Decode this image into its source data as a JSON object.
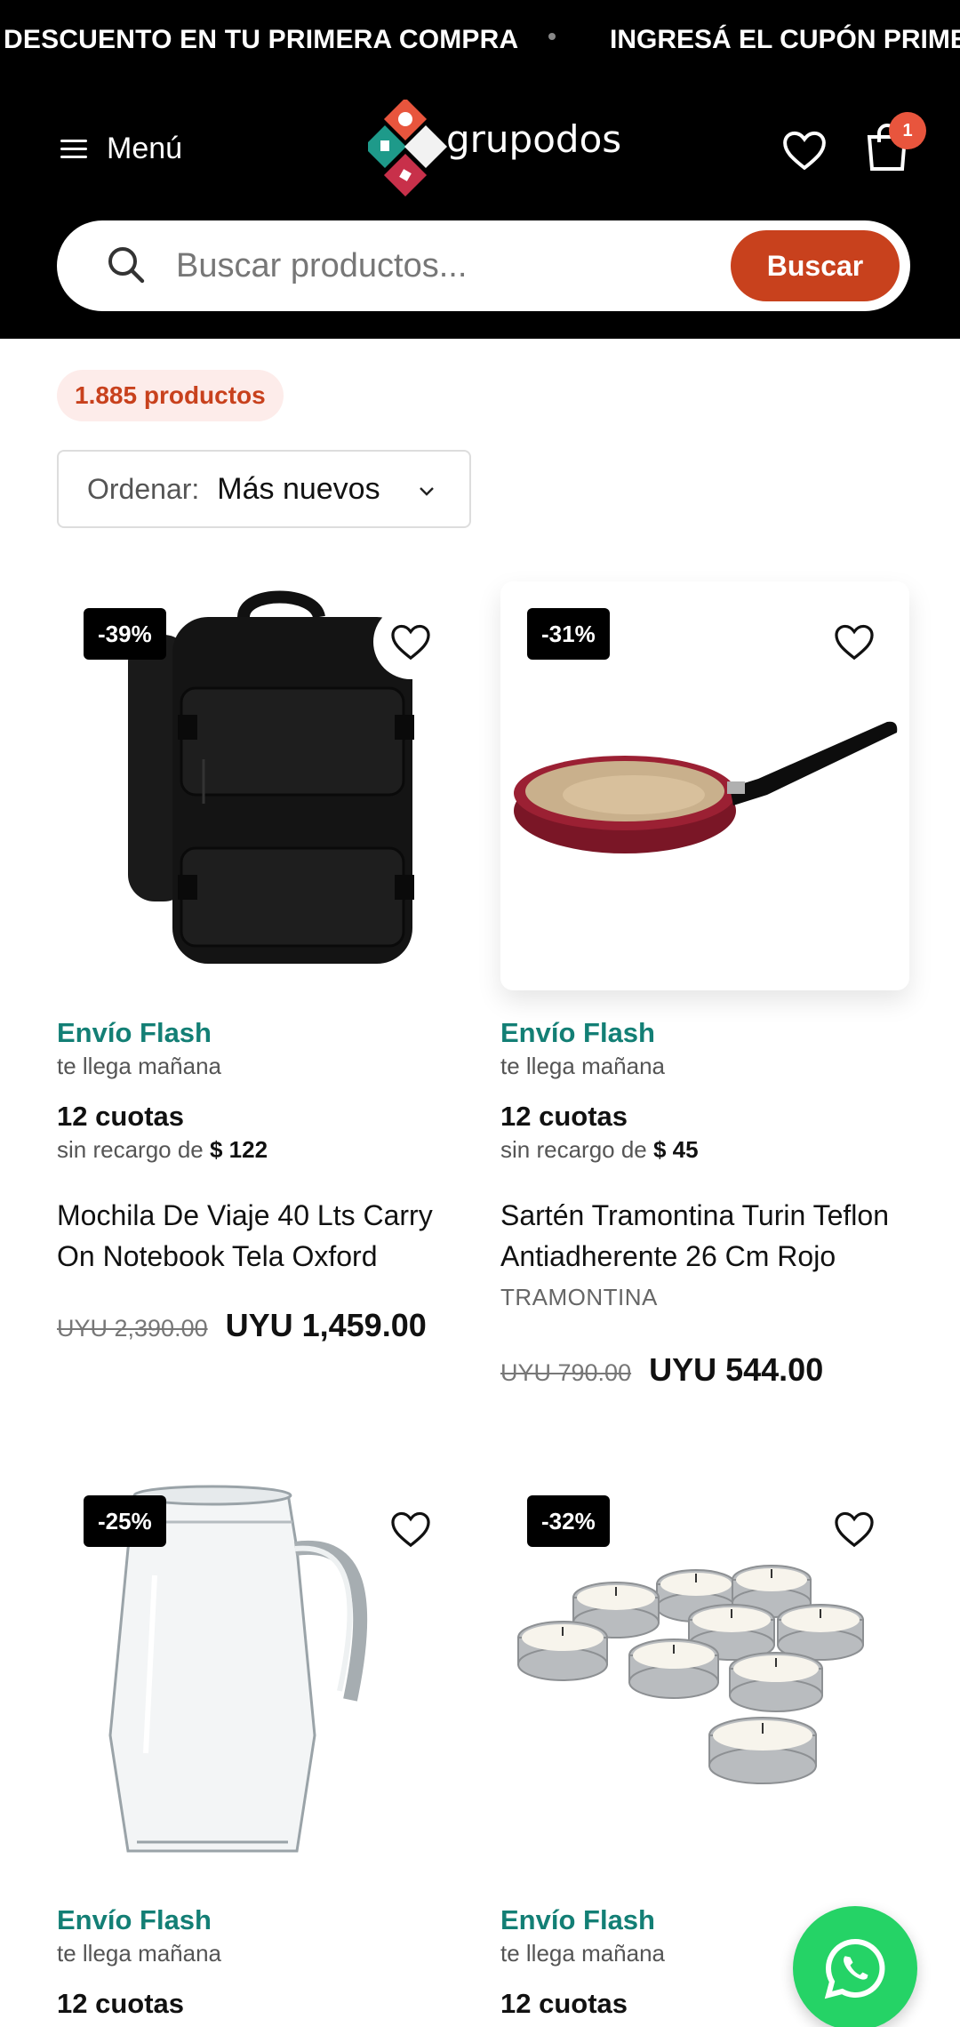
{
  "announcement": {
    "message_1": "DESCUENTO EN TU PRIMERA COMPRA",
    "message_2": "INGRESÁ EL CUPÓN PRIMER"
  },
  "header": {
    "menu_label": "Menú",
    "logo_text": "grupodos",
    "cart_count": "1",
    "search_placeholder": "Buscar productos...",
    "search_button": "Buscar"
  },
  "listing": {
    "count_label": "1.885 productos",
    "sort_label": "Ordenar:",
    "sort_value": "Más nuevos"
  },
  "products": [
    {
      "discount": "-39%",
      "shipping": "Envío Flash",
      "shipping_note": "te llega mañana",
      "installments": "12 cuotas",
      "installment_text": "sin recargo de",
      "installment_amount": "$ 122",
      "title": "Mochila De Viaje 40 Lts Carry On Notebook Tela Oxford",
      "brand": "",
      "old_price": "UYU 2,390.00",
      "price": "UYU 1,459.00",
      "image": "backpack"
    },
    {
      "discount": "-31%",
      "shipping": "Envío Flash",
      "shipping_note": "te llega mañana",
      "installments": "12 cuotas",
      "installment_text": "sin recargo de",
      "installment_amount": "$ 45",
      "title": "Sartén Tramontina Turin Teflon Antiadherente 26 Cm Rojo",
      "brand": "TRAMONTINA",
      "old_price": "UYU 790.00",
      "price": "UYU 544.00",
      "image": "frying-pan"
    },
    {
      "discount": "-25%",
      "shipping": "Envío Flash",
      "shipping_note": "te llega mañana",
      "installments": "12 cuotas",
      "image": "glass-pitcher"
    },
    {
      "discount": "-32%",
      "shipping": "Envío Flash",
      "shipping_note": "te llega mañana",
      "installments": "12 cuotas",
      "image": "tealight-candles"
    }
  ],
  "colors": {
    "accent": "#c8411d",
    "shipping_green": "#137f75",
    "badge": "#e8553d",
    "whatsapp": "#25d366"
  }
}
